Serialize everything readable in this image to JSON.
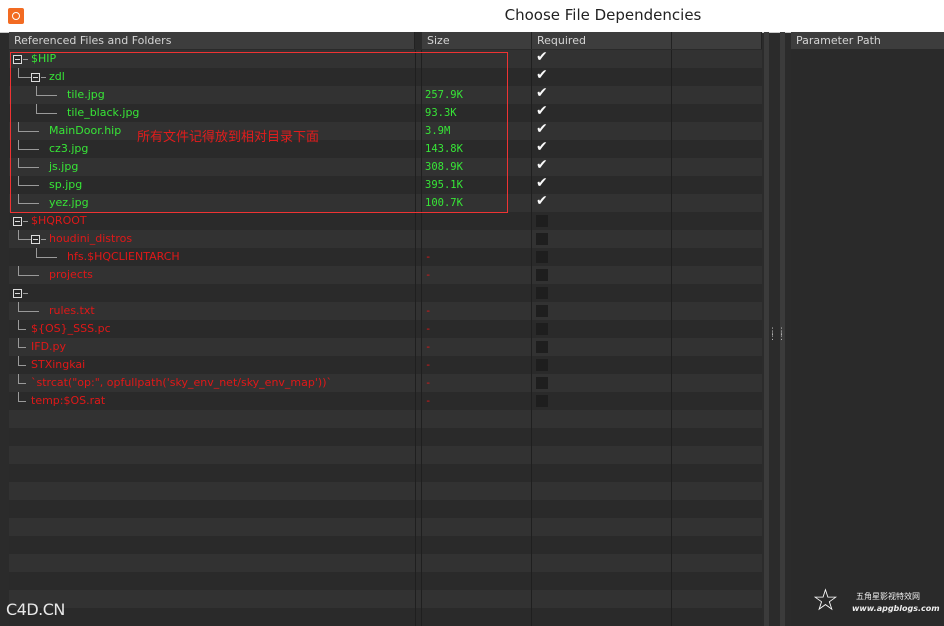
{
  "window": {
    "title": "Choose File Dependencies"
  },
  "columns": {
    "name": "Referenced Files and Folders",
    "size": "Size",
    "required": "Required",
    "param": "Parameter Path"
  },
  "colors": {
    "found": "#37e637",
    "missing": "#e01818",
    "annotation": "#e33333"
  },
  "annotation": "所有文件记得放到相对目录下面",
  "rows": [
    {
      "label": "$HIP",
      "depth": 0,
      "expander": true,
      "status": "found",
      "size": "",
      "required": true
    },
    {
      "label": "zdl",
      "depth": 1,
      "expander": true,
      "status": "found",
      "size": "",
      "required": true
    },
    {
      "label": "tile.jpg",
      "depth": 2,
      "expander": false,
      "status": "found",
      "size": "257.9K",
      "required": true
    },
    {
      "label": "tile_black.jpg",
      "depth": 2,
      "expander": false,
      "status": "found",
      "size": "93.3K",
      "required": true
    },
    {
      "label": "MainDoor.hip",
      "depth": 1,
      "expander": false,
      "status": "found",
      "size": "3.9M",
      "required": true
    },
    {
      "label": "cz3.jpg",
      "depth": 1,
      "expander": false,
      "status": "found",
      "size": "143.8K",
      "required": true
    },
    {
      "label": "js.jpg",
      "depth": 1,
      "expander": false,
      "status": "found",
      "size": "308.9K",
      "required": true
    },
    {
      "label": "sp.jpg",
      "depth": 1,
      "expander": false,
      "status": "found",
      "size": "395.1K",
      "required": true
    },
    {
      "label": "yez.jpg",
      "depth": 1,
      "expander": false,
      "status": "found",
      "size": "100.7K",
      "required": true
    },
    {
      "label": "$HQROOT",
      "depth": 0,
      "expander": true,
      "status": "missing",
      "size": "",
      "required": false
    },
    {
      "label": "houdini_distros",
      "depth": 1,
      "expander": true,
      "status": "missing",
      "size": "",
      "required": false
    },
    {
      "label": "hfs.$HQCLIENTARCH",
      "depth": 2,
      "expander": false,
      "status": "missing",
      "size": "-",
      "required": false
    },
    {
      "label": "projects",
      "depth": 1,
      "expander": false,
      "status": "missing",
      "size": "-",
      "required": false
    },
    {
      "label": "",
      "depth": 0,
      "expander": true,
      "status": "missing",
      "size": "",
      "required": false
    },
    {
      "label": "rules.txt",
      "depth": 1,
      "expander": false,
      "status": "missing",
      "size": "-",
      "required": false
    },
    {
      "label": "${OS}_SSS.pc",
      "depth": 0,
      "expander": false,
      "status": "missing",
      "size": "-",
      "required": false
    },
    {
      "label": "IFD.py",
      "depth": 0,
      "expander": false,
      "status": "missing",
      "size": "-",
      "required": false
    },
    {
      "label": "STXingkai",
      "depth": 0,
      "expander": false,
      "status": "missing",
      "size": "-",
      "required": false
    },
    {
      "label": "`strcat(\"op:\", opfullpath('sky_env_net/sky_env_map'))`",
      "depth": 0,
      "expander": false,
      "status": "missing",
      "size": "-",
      "required": false
    },
    {
      "label": "temp:$OS.rat",
      "depth": 0,
      "expander": false,
      "status": "missing",
      "size": "-",
      "required": false
    }
  ],
  "watermark_left": "C4D.CN",
  "watermark_right": {
    "name": "五角星影视特效网",
    "url": "www.apgblogs.com",
    "logo_icon": "star-icon"
  }
}
